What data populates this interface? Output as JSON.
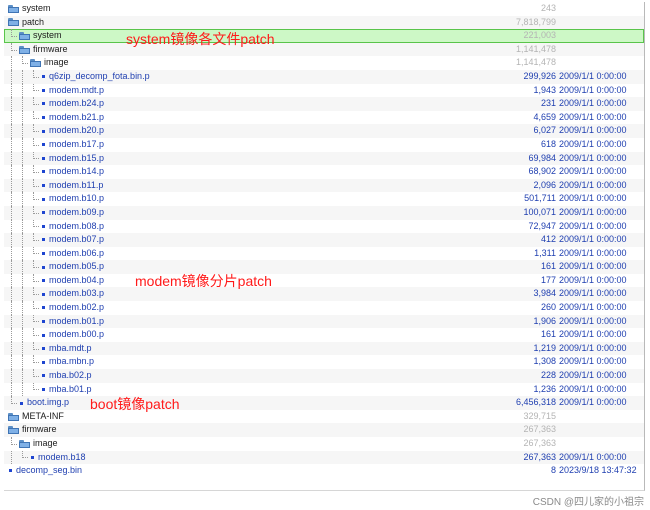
{
  "rows": [
    {
      "name": "system",
      "type": "folder",
      "depth": 0,
      "size": "243",
      "date": "",
      "dim": true
    },
    {
      "name": "patch",
      "type": "folder-open",
      "depth": 0,
      "size": "7,818,799",
      "date": "",
      "dim": true
    },
    {
      "name": "system",
      "type": "folder-open",
      "depth": 1,
      "size": "221,003",
      "date": "",
      "dim": true,
      "selected": true
    },
    {
      "name": "firmware",
      "type": "folder-open",
      "depth": 1,
      "size": "1,141,478",
      "date": "",
      "dim": true
    },
    {
      "name": "image",
      "type": "folder-open",
      "depth": 2,
      "size": "1,141,478",
      "date": "",
      "dim": true
    },
    {
      "name": "q6zip_decomp_fota.bin.p",
      "type": "file",
      "depth": 3,
      "size": "299,926",
      "date": "2009/1/1 0:00:00"
    },
    {
      "name": "modem.mdt.p",
      "type": "file",
      "depth": 3,
      "size": "1,943",
      "date": "2009/1/1 0:00:00"
    },
    {
      "name": "modem.b24.p",
      "type": "file",
      "depth": 3,
      "size": "231",
      "date": "2009/1/1 0:00:00"
    },
    {
      "name": "modem.b21.p",
      "type": "file",
      "depth": 3,
      "size": "4,659",
      "date": "2009/1/1 0:00:00"
    },
    {
      "name": "modem.b20.p",
      "type": "file",
      "depth": 3,
      "size": "6,027",
      "date": "2009/1/1 0:00:00"
    },
    {
      "name": "modem.b17.p",
      "type": "file",
      "depth": 3,
      "size": "618",
      "date": "2009/1/1 0:00:00"
    },
    {
      "name": "modem.b15.p",
      "type": "file",
      "depth": 3,
      "size": "69,984",
      "date": "2009/1/1 0:00:00"
    },
    {
      "name": "modem.b14.p",
      "type": "file",
      "depth": 3,
      "size": "68,902",
      "date": "2009/1/1 0:00:00"
    },
    {
      "name": "modem.b11.p",
      "type": "file",
      "depth": 3,
      "size": "2,096",
      "date": "2009/1/1 0:00:00"
    },
    {
      "name": "modem.b10.p",
      "type": "file",
      "depth": 3,
      "size": "501,711",
      "date": "2009/1/1 0:00:00"
    },
    {
      "name": "modem.b09.p",
      "type": "file",
      "depth": 3,
      "size": "100,071",
      "date": "2009/1/1 0:00:00"
    },
    {
      "name": "modem.b08.p",
      "type": "file",
      "depth": 3,
      "size": "72,947",
      "date": "2009/1/1 0:00:00"
    },
    {
      "name": "modem.b07.p",
      "type": "file",
      "depth": 3,
      "size": "412",
      "date": "2009/1/1 0:00:00"
    },
    {
      "name": "modem.b06.p",
      "type": "file",
      "depth": 3,
      "size": "1,311",
      "date": "2009/1/1 0:00:00"
    },
    {
      "name": "modem.b05.p",
      "type": "file",
      "depth": 3,
      "size": "161",
      "date": "2009/1/1 0:00:00"
    },
    {
      "name": "modem.b04.p",
      "type": "file",
      "depth": 3,
      "size": "177",
      "date": "2009/1/1 0:00:00"
    },
    {
      "name": "modem.b03.p",
      "type": "file",
      "depth": 3,
      "size": "3,984",
      "date": "2009/1/1 0:00:00"
    },
    {
      "name": "modem.b02.p",
      "type": "file",
      "depth": 3,
      "size": "260",
      "date": "2009/1/1 0:00:00"
    },
    {
      "name": "modem.b01.p",
      "type": "file",
      "depth": 3,
      "size": "1,906",
      "date": "2009/1/1 0:00:00"
    },
    {
      "name": "modem.b00.p",
      "type": "file",
      "depth": 3,
      "size": "161",
      "date": "2009/1/1 0:00:00"
    },
    {
      "name": "mba.mdt.p",
      "type": "file",
      "depth": 3,
      "size": "1,219",
      "date": "2009/1/1 0:00:00"
    },
    {
      "name": "mba.mbn.p",
      "type": "file",
      "depth": 3,
      "size": "1,308",
      "date": "2009/1/1 0:00:00"
    },
    {
      "name": "mba.b02.p",
      "type": "file",
      "depth": 3,
      "size": "228",
      "date": "2009/1/1 0:00:00"
    },
    {
      "name": "mba.b01.p",
      "type": "file",
      "depth": 3,
      "size": "1,236",
      "date": "2009/1/1 0:00:00"
    },
    {
      "name": "boot.img.p",
      "type": "file",
      "depth": 1,
      "size": "6,456,318",
      "date": "2009/1/1 0:00:00"
    },
    {
      "name": "META-INF",
      "type": "folder",
      "depth": 0,
      "size": "329,715",
      "date": "",
      "dim": true
    },
    {
      "name": "firmware",
      "type": "folder-open",
      "depth": 0,
      "size": "267,363",
      "date": "",
      "dim": true
    },
    {
      "name": "image",
      "type": "folder-open",
      "depth": 1,
      "size": "267,363",
      "date": "",
      "dim": true
    },
    {
      "name": "modem.b18",
      "type": "file",
      "depth": 2,
      "size": "267,363",
      "date": "2009/1/1 0:00:00"
    },
    {
      "name": "decomp_seg.bin",
      "type": "file",
      "depth": 0,
      "size": "8",
      "date": "2023/9/18 13:47:32"
    }
  ],
  "annotations": {
    "system": "system镜像各文件patch",
    "modem": "modem镜像分片patch",
    "boot": "boot镜像patch"
  },
  "watermark": "CSDN @四儿家的小祖宗",
  "colors": {
    "annotation": "#ff1a1a",
    "selection_bg": "#cdf8c6",
    "selection_border": "#59c44a",
    "file_text": "#1f3fb0"
  }
}
